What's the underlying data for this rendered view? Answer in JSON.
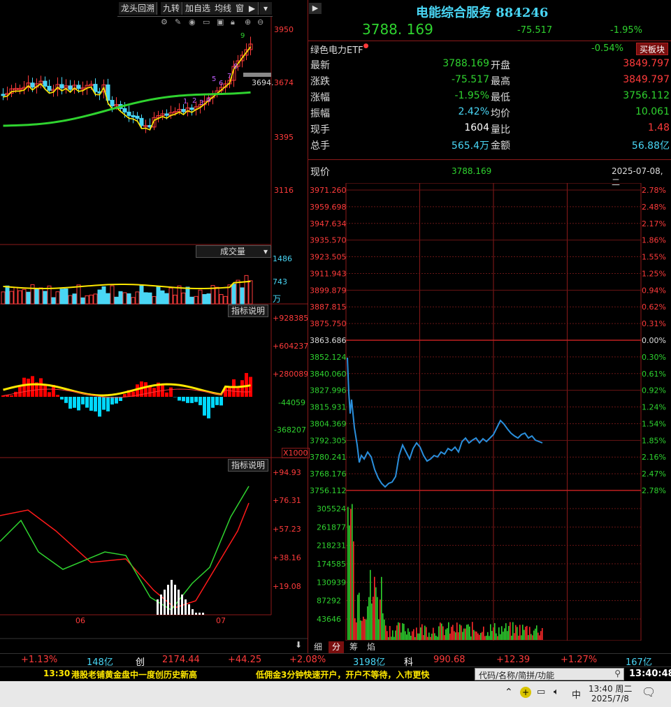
{
  "left_toolbar": {
    "buttons": [
      "龙头回溯",
      "九转",
      "加自选",
      "均线",
      "窗"
    ],
    "play_icon": "play-icon",
    "menu_icon": "chevron-down-icon"
  },
  "kline": {
    "y_labels": [
      "3950",
      "3674",
      "3395",
      "3116"
    ],
    "price_tag": "3694.",
    "nine_turn_digits": [
      "1",
      "2",
      "3",
      "4",
      "5",
      "6",
      "7",
      "8",
      "9"
    ]
  },
  "volume": {
    "dropdown_label": "成交量",
    "y_labels": [
      "1486",
      "743"
    ],
    "unit": "万"
  },
  "macd": {
    "help_label": "指标说明",
    "y_labels": [
      "+928385",
      "+604237",
      "+280089",
      "-44059",
      "-368207"
    ],
    "multiplier": "X1000"
  },
  "kdj": {
    "help_label": "指标说明",
    "y_labels": [
      "+94.93",
      "+76.31",
      "+57.23",
      "+38.16",
      "+19.08"
    ],
    "x_labels": [
      "06",
      "07"
    ]
  },
  "header": {
    "title": "电能综合服务 884246",
    "price": "3788. 169",
    "change": "-75.517",
    "change_pct": "-1.95%"
  },
  "related": {
    "name": "绿色电力ETF",
    "pct": "-0.54%",
    "button": "买板块"
  },
  "quotes": [
    {
      "l": "最新",
      "v": "3788.169",
      "l2": "开盘",
      "v2": "3849.797",
      "c1": "green",
      "c2": "red"
    },
    {
      "l": "涨跌",
      "v": "-75.517",
      "l2": "最高",
      "v2": "3849.797",
      "c1": "green",
      "c2": "red"
    },
    {
      "l": "涨幅",
      "v": "-1.95%",
      "l2": "最低",
      "v2": "3756.112",
      "c1": "green",
      "c2": "green"
    },
    {
      "l": "振幅",
      "v": "2.42%",
      "l2": "均价",
      "v2": "10.061",
      "c1": "cyan",
      "c2": "green"
    },
    {
      "l": "现手",
      "v": "1604",
      "l2": "量比",
      "v2": "1.48",
      "c1": "white",
      "c2": "red"
    },
    {
      "l": "总手",
      "v": "565.4万",
      "l2": "金额",
      "v2": "56.88亿",
      "c1": "cyan",
      "c2": "cyan"
    }
  ],
  "now_row": {
    "label": "现价",
    "price": "3788.169",
    "date": "2025-07-08,二"
  },
  "intraday": {
    "price_labels": [
      "3971.260",
      "3959.698",
      "3947.634",
      "3935.570",
      "3923.505",
      "3911.943",
      "3899.879",
      "3887.815",
      "3875.750",
      "3863.686",
      "3852.124",
      "3840.060",
      "3827.996",
      "3815.931",
      "3804.369",
      "3792.305",
      "3780.241",
      "3768.176",
      "3756.112"
    ],
    "pct_labels": [
      "2.78%",
      "2.48%",
      "2.17%",
      "1.86%",
      "1.55%",
      "1.25%",
      "0.94%",
      "0.62%",
      "0.31%",
      "0.00%",
      "0.30%",
      "0.61%",
      "0.92%",
      "1.24%",
      "1.54%",
      "1.85%",
      "2.16%",
      "2.47%",
      "2.78%"
    ],
    "volume_labels": [
      "305524",
      "261877",
      "218231",
      "174585",
      "130939",
      "87292",
      "43646"
    ],
    "line_color": "#2a8fdc"
  },
  "bottom_tabs": [
    "细",
    "分",
    "筹",
    "焰"
  ],
  "status_bar": {
    "items": [
      {
        "t": "+1.13%",
        "c": "red"
      },
      {
        "t": "148亿",
        "c": "cyan"
      },
      {
        "t": "创",
        "c": "white"
      },
      {
        "t": "2174.44",
        "c": "red"
      },
      {
        "t": "+44.25",
        "c": "red"
      },
      {
        "t": "+2.08%",
        "c": "red"
      },
      {
        "t": "3198亿",
        "c": "cyan"
      },
      {
        "t": "科",
        "c": "white"
      },
      {
        "t": "990.68",
        "c": "red"
      },
      {
        "t": "+12.39",
        "c": "red"
      },
      {
        "t": "+1.27%",
        "c": "red"
      },
      {
        "t": "167亿",
        "c": "cyan"
      }
    ]
  },
  "ticker": {
    "time": "13:30",
    "news": "港股老铺黄金盘中一度创历史新高",
    "ad": "低佣金3分钟快速开户，开户不等待，入市更快",
    "search_placeholder": "代码/名称/简拼/功能",
    "clock": "13:40:48"
  },
  "taskbar": {
    "ime": "中",
    "time": "13:40 周二",
    "date": "2025/7/8"
  }
}
